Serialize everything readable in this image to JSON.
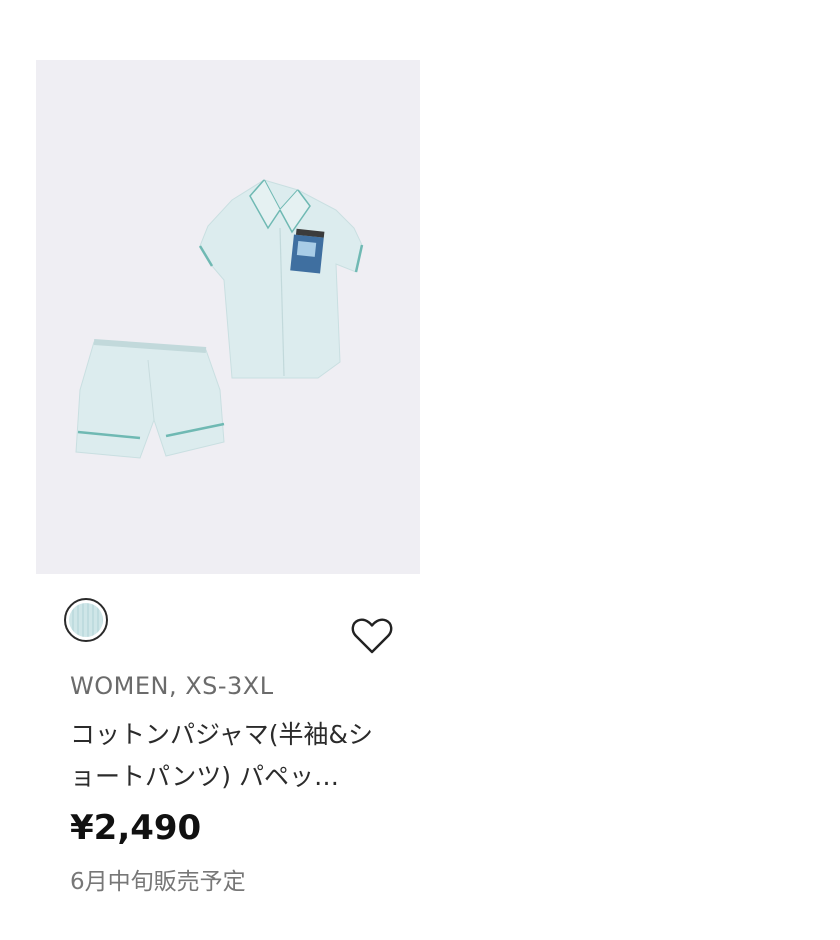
{
  "product": {
    "image_alt": "コットンパジャマ(半袖&ショートパンツ) パペッ…",
    "swatch_color": "#cfe6e8",
    "meta": "WOMEN, XS-3XL",
    "name": "コットンパジャマ(半袖&ショートパンツ) パペッ…",
    "price": "¥2,490",
    "release": "6月中旬販売予定"
  },
  "icons": {
    "favorite": "heart-outline-icon"
  },
  "colors": {
    "image_bg": "#efeef3",
    "fabric": "#dcecee",
    "piping": "#6fb9b3"
  }
}
